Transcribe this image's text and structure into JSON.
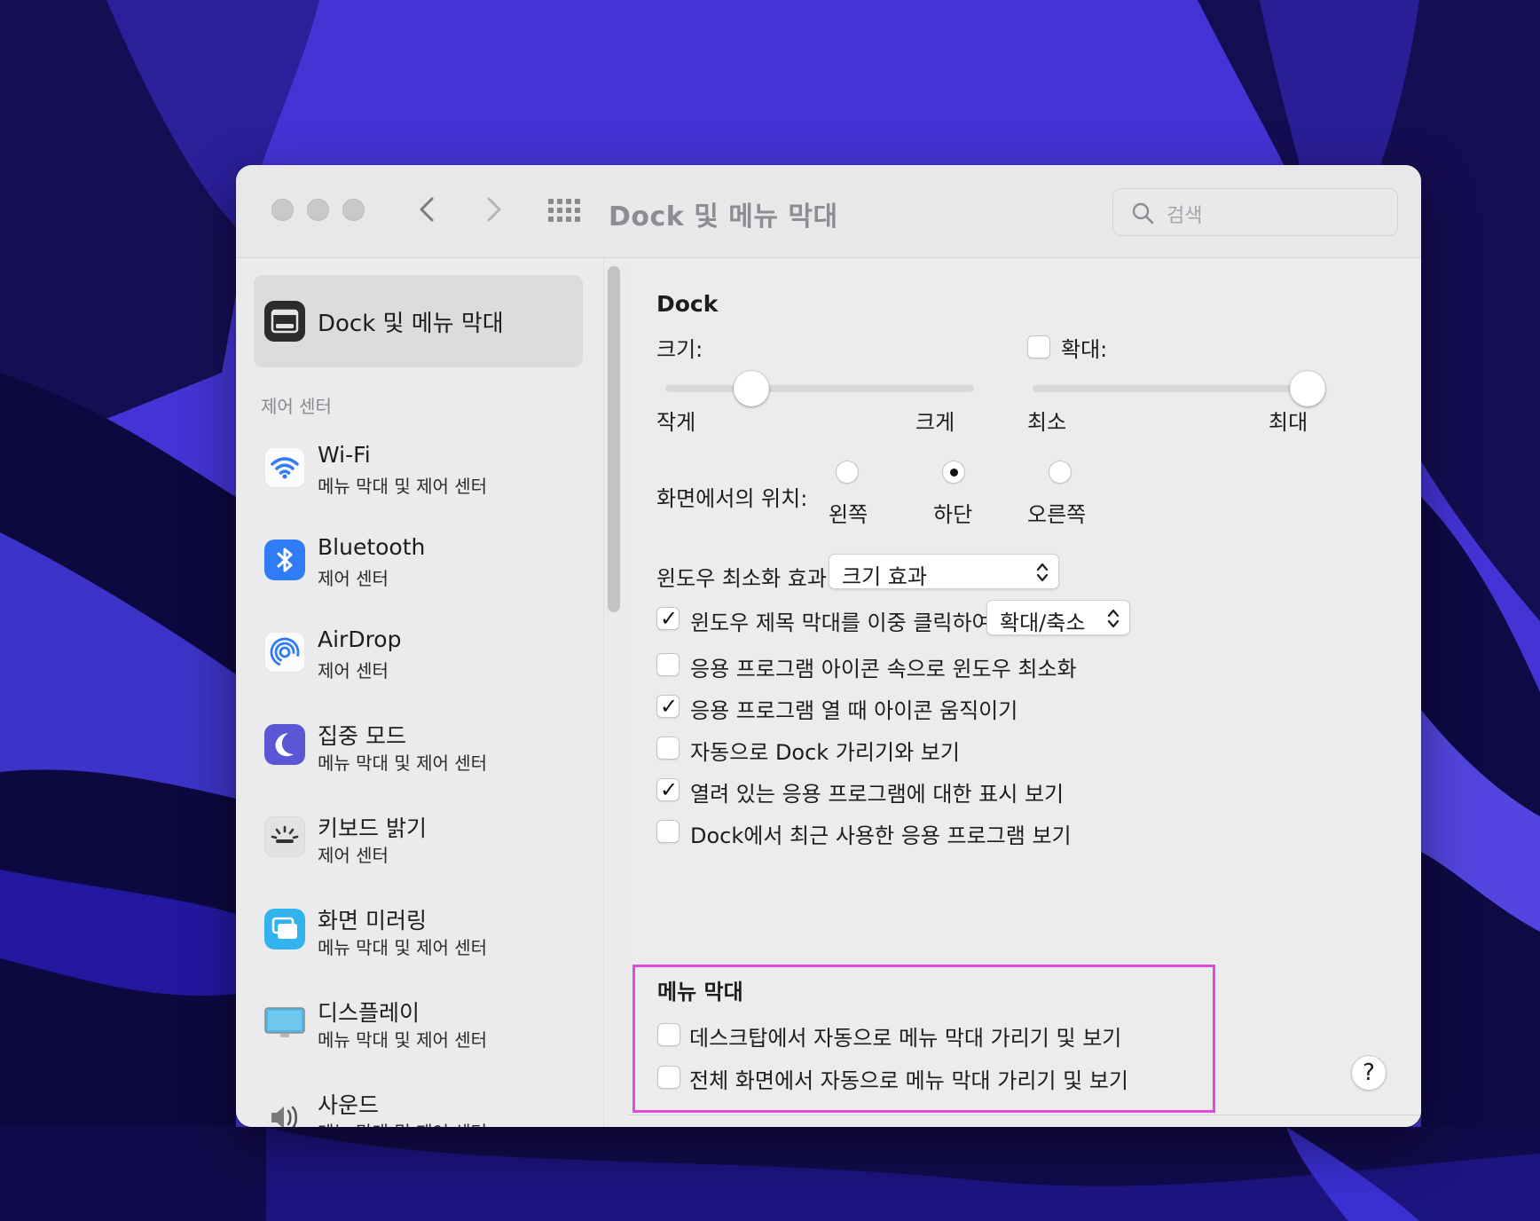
{
  "window": {
    "title": "Dock 및 메뉴 막대",
    "search_placeholder": "검색"
  },
  "sidebar": {
    "selected": {
      "label": "Dock 및 메뉴 막대",
      "icon": "dock-menubar-icon"
    },
    "section_label": "제어 센터",
    "items": [
      {
        "label": "Wi-Fi",
        "sub": "메뉴 막대 및 제어 센터",
        "icon": "wifi-icon"
      },
      {
        "label": "Bluetooth",
        "sub": "제어 센터",
        "icon": "bluetooth-icon"
      },
      {
        "label": "AirDrop",
        "sub": "제어 센터",
        "icon": "airdrop-icon"
      },
      {
        "label": "집중 모드",
        "sub": "메뉴 막대 및 제어 센터",
        "icon": "moon-icon"
      },
      {
        "label": "키보드 밝기",
        "sub": "제어 센터",
        "icon": "keyboard-brightness-icon"
      },
      {
        "label": "화면 미러링",
        "sub": "메뉴 막대 및 제어 센터",
        "icon": "screen-mirroring-icon"
      },
      {
        "label": "디스플레이",
        "sub": "메뉴 막대 및 제어 센터",
        "icon": "display-icon"
      },
      {
        "label": "사운드",
        "sub": "메뉴 막대 및 제어 센터",
        "icon": "sound-icon"
      }
    ]
  },
  "dock": {
    "heading": "Dock",
    "size_label": "크기:",
    "size_min": "작게",
    "size_max": "크게",
    "size_value": 0.28,
    "magnify_label": "확대:",
    "magnify_checked": false,
    "magnify_min": "최소",
    "magnify_max": "최대",
    "magnify_value": 1.0,
    "position_label": "화면에서의 위치:",
    "positions": [
      {
        "label": "왼쪽",
        "selected": false
      },
      {
        "label": "하단",
        "selected": true
      },
      {
        "label": "오른쪽",
        "selected": false
      }
    ],
    "minimize_label": "윈도우 최소화 효과:",
    "minimize_value": "크기 효과",
    "doubleclick_label": "윈도우 제목 막대를 이중 클릭하여",
    "doubleclick_checked": true,
    "doubleclick_value": "확대/축소",
    "options": [
      {
        "label": "응용 프로그램 아이콘 속으로 윈도우 최소화",
        "checked": false
      },
      {
        "label": "응용 프로그램 열 때 아이콘 움직이기",
        "checked": true
      },
      {
        "label": "자동으로 Dock 가리기와 보기",
        "checked": false
      },
      {
        "label": "열려 있는 응용 프로그램에 대한 표시 보기",
        "checked": true
      },
      {
        "label": "Dock에서 최근 사용한 응용 프로그램 보기",
        "checked": false
      }
    ]
  },
  "menubar": {
    "heading": "메뉴 막대",
    "options": [
      {
        "label": "데스크탑에서 자동으로 메뉴 막대 가리기 및 보기",
        "checked": false
      },
      {
        "label": "전체 화면에서 자동으로 메뉴 막대 가리기 및 보기",
        "checked": false
      }
    ]
  },
  "help_label": "?",
  "colors": {
    "highlight": "#e04ae0",
    "accent": "#2f7cf6",
    "wallpaper": "#3a2fd0"
  }
}
